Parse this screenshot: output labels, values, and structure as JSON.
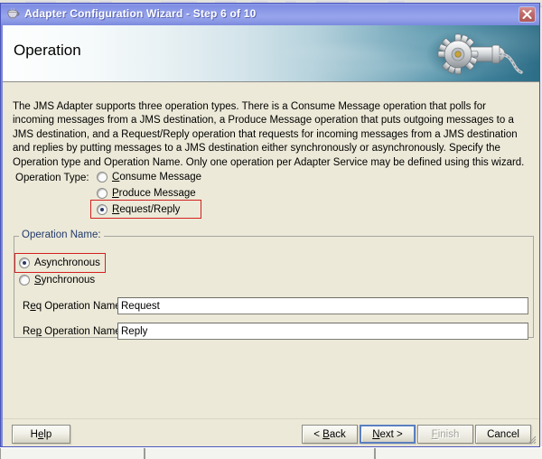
{
  "window": {
    "title": "Adapter Configuration Wizard - Step 6 of 10",
    "app_icon": "coffee-cup-icon",
    "close_label": "✕"
  },
  "banner": {
    "heading": "Operation",
    "art": "gear-machinery-icon"
  },
  "main": {
    "intro": "The JMS Adapter supports three operation types.  There is a Consume Message operation that polls for incoming messages from a JMS destination, a Produce Message operation that puts outgoing messages to a JMS destination, and a Request/Reply operation that requests for incoming messages from a JMS destination and replies by putting messages to a JMS destination either synchronously or asynchronously.  Specify the Operation type and Operation Name.  Only one operation per Adapter Service may be defined using this wizard.",
    "operation_type": {
      "label": "Operation Type:",
      "options": [
        {
          "mnemonic": "C",
          "rest": "onsume Message",
          "checked": false,
          "highlighted": false
        },
        {
          "mnemonic": "P",
          "rest": "roduce Message",
          "checked": false,
          "highlighted": false
        },
        {
          "mnemonic": "R",
          "rest": "equest/Reply",
          "checked": true,
          "highlighted": true
        }
      ]
    },
    "operation_name": {
      "group_title": "Operation Name:",
      "options": [
        {
          "pre": "A",
          "mnemonic": "",
          "rest": "synchronous",
          "label": "Asynchronous",
          "checked": true,
          "highlighted": true
        },
        {
          "pre": "",
          "mnemonic": "S",
          "rest": "ynchronous",
          "label": "Synchronous",
          "checked": false,
          "highlighted": false
        }
      ],
      "fields": [
        {
          "pre": "R",
          "mnemonic": "e",
          "post": "q Operation Name",
          "value": "Request"
        },
        {
          "pre": "Re",
          "mnemonic": "p",
          "post": " Operation Name",
          "value": "Reply"
        }
      ]
    }
  },
  "footer": {
    "help": "Help",
    "back": "< Back",
    "next": "Next >",
    "finish": "Finish",
    "cancel": "Cancel",
    "back_mnemonic": "B",
    "next_mnemonic": "N",
    "finish_mnemonic": "F",
    "help_mnemonic": "e"
  },
  "colors": {
    "titlebar": "#8c9ae8",
    "highlight": "#d42020",
    "banner_teal": "#2d6d86",
    "panel": "#ece9d8"
  }
}
